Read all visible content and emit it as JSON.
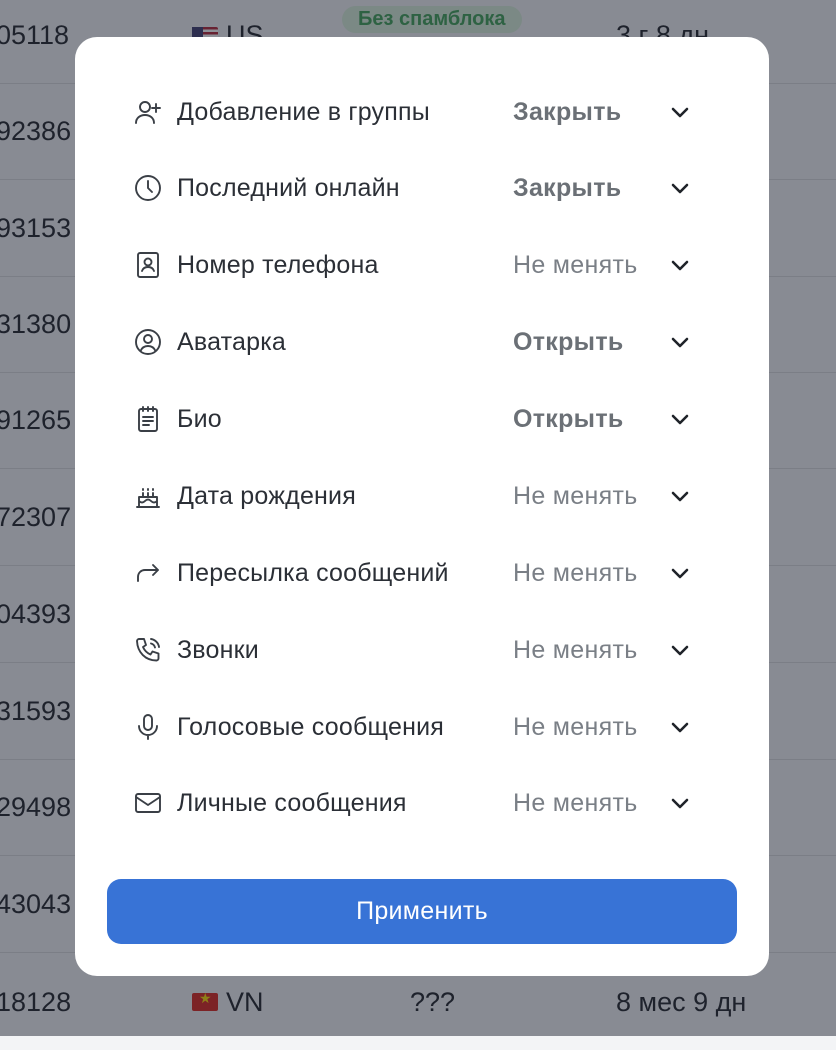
{
  "background_table": {
    "rows": [
      {
        "id": "05118",
        "country": "US",
        "flag": "us",
        "badge": "Без спамблока",
        "time": "3 г 8 дн"
      },
      {
        "id": "92386"
      },
      {
        "id": "93153"
      },
      {
        "id": "31380"
      },
      {
        "id": "91265"
      },
      {
        "id": "72307"
      },
      {
        "id": "04393"
      },
      {
        "id": "31593"
      },
      {
        "id": "29498"
      },
      {
        "id": "43043"
      },
      {
        "id": "18128",
        "country": "VN",
        "flag": "vn",
        "status": "???",
        "time": "8 мес 9 дн"
      }
    ]
  },
  "privacy_settings": {
    "rows": [
      {
        "icon": "add-user-icon",
        "label": "Добавление в группы",
        "value": "Закрыть",
        "emphasis": true
      },
      {
        "icon": "clock-icon",
        "label": "Последний онлайн",
        "value": "Закрыть",
        "emphasis": true
      },
      {
        "icon": "contact-book-icon",
        "label": "Номер телефона",
        "value": "Не менять",
        "emphasis": false
      },
      {
        "icon": "user-circle-icon",
        "label": "Аватарка",
        "value": "Открыть",
        "emphasis": true
      },
      {
        "icon": "notepad-icon",
        "label": "Био",
        "value": "Открыть",
        "emphasis": true
      },
      {
        "icon": "cake-icon",
        "label": "Дата рождения",
        "value": "Не менять",
        "emphasis": false
      },
      {
        "icon": "forward-arrow-icon",
        "label": "Пересылка сообщений",
        "value": "Не менять",
        "emphasis": false
      },
      {
        "icon": "phone-call-icon",
        "label": "Звонки",
        "value": "Не менять",
        "emphasis": false
      },
      {
        "icon": "microphone-icon",
        "label": "Голосовые сообщения",
        "value": "Не менять",
        "emphasis": false
      },
      {
        "icon": "envelope-icon",
        "label": "Личные сообщения",
        "value": "Не менять",
        "emphasis": false
      }
    ],
    "apply_label": "Применить"
  },
  "colors": {
    "accent": "#3873d6",
    "overlay": "#1e2230",
    "badge_green": "#3fa257"
  }
}
